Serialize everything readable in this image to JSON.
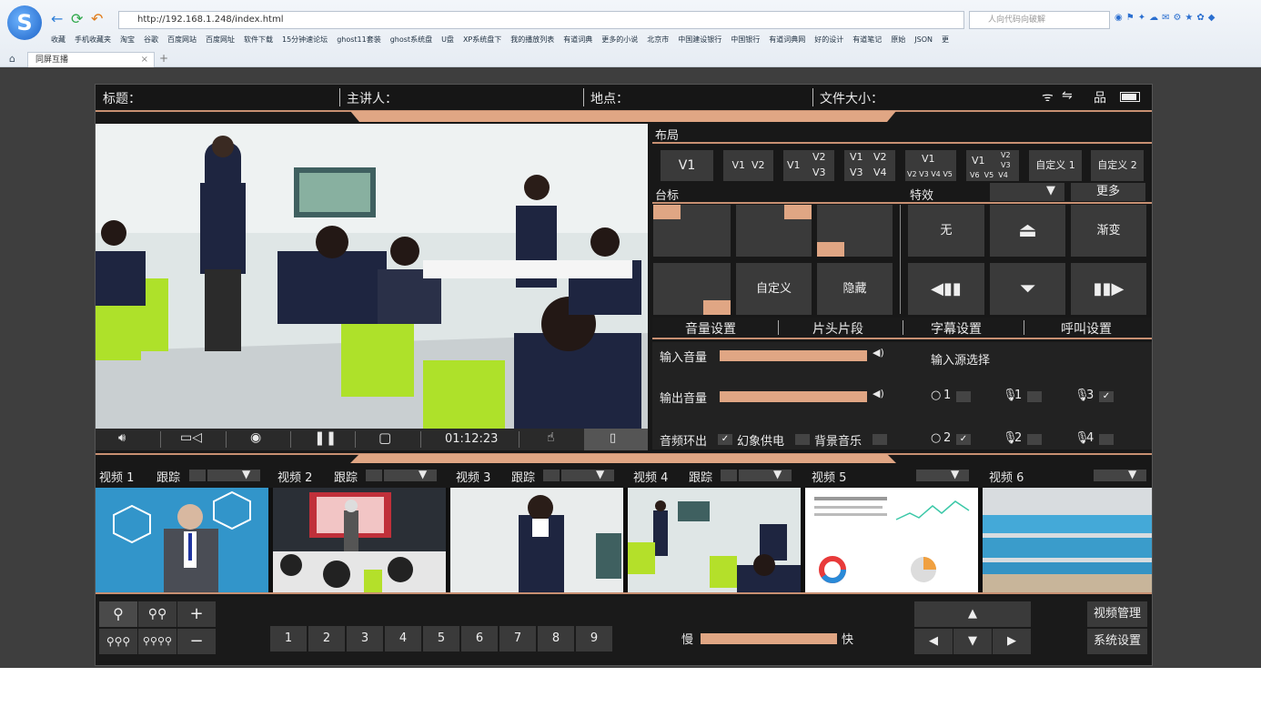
{
  "browser": {
    "url": "http://192.168.1.248/index.html",
    "search_placeholder": "人向代码向破解",
    "tab_title": "同屏互播",
    "bookmarks": [
      "收藏",
      "手机收藏夹",
      "淘宝",
      "谷歌",
      "百度网站",
      "百度网址",
      "软件下载",
      "15分钟速论坛",
      "ghost11套装",
      "ghost系统盘",
      "U盘",
      "XP系统盘下",
      "我的播放列表",
      "有道词典",
      "更多的小说",
      "北京市",
      "中国建设银行",
      "中国银行",
      "有道词典网",
      "好的设计",
      "有道笔记",
      "原始",
      "JSON",
      "更"
    ]
  },
  "topbar": {
    "title_label": "标题：",
    "speaker_label": "主讲人：",
    "location_label": "地点：",
    "filesize_label": "文件大小："
  },
  "layout": {
    "header": "布局",
    "buttons": [
      "V1",
      "V1 V2",
      "V1 V2 V3",
      "V1 V2 V3 V4",
      "V1 V2 V3 V4 V5",
      "V1 V2 V3 V6 V5 V4",
      "自定义 1",
      "自定义 2"
    ]
  },
  "logo_section": {
    "header": "台标",
    "custom": "自定义",
    "hide": "隐藏"
  },
  "effects": {
    "header": "特效",
    "more": "更多",
    "none": "无",
    "fade": "渐变"
  },
  "tabs": [
    "音量设置",
    "片头片段",
    "字幕设置",
    "呼叫设置"
  ],
  "volume": {
    "input_label": "输入音量",
    "output_label": "输出音量",
    "loop_label": "音频环出",
    "phantom_label": "幻象供电",
    "bgm_label": "背景音乐",
    "input_level": 1.0,
    "output_level": 1.0,
    "loop_checked": true
  },
  "source": {
    "header": "输入源选择",
    "items": [
      {
        "label": "1",
        "checked": false
      },
      {
        "label": "1",
        "checked": false
      },
      {
        "label": "3",
        "checked": true
      },
      {
        "label": "2",
        "checked": true
      },
      {
        "label": "2",
        "checked": false
      },
      {
        "label": "4",
        "checked": false
      }
    ]
  },
  "controls": {
    "timer": "01:12:23"
  },
  "videos": [
    {
      "label": "视频 1",
      "track": "跟踪"
    },
    {
      "label": "视频 2",
      "track": "跟踪"
    },
    {
      "label": "视频 3",
      "track": "跟踪"
    },
    {
      "label": "视频 4",
      "track": "跟踪"
    },
    {
      "label": "视频 5",
      "track": ""
    },
    {
      "label": "视频 6",
      "track": ""
    }
  ],
  "bottom": {
    "plus": "+",
    "minus": "−",
    "numbers": [
      "1",
      "2",
      "3",
      "4",
      "5",
      "6",
      "7",
      "8",
      "9"
    ],
    "slow": "慢",
    "fast": "快",
    "speed_level": 1.0,
    "video_manage": "视频管理",
    "system_settings": "系统设置"
  },
  "colors": {
    "accent": "#e0a684",
    "panel": "#3a3a3a",
    "background": "#181818"
  }
}
